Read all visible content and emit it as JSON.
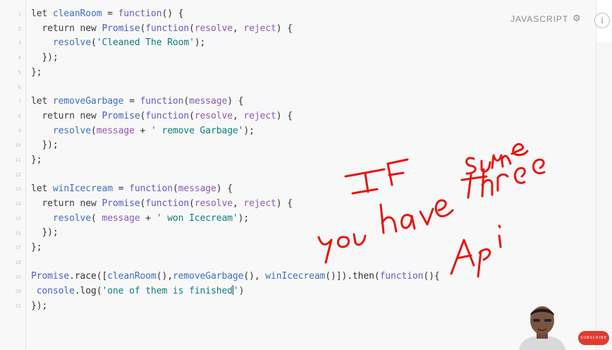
{
  "header": {
    "language": "JAVASCRIPT",
    "settings_icon": "gear-icon",
    "info_icon": "info-icon"
  },
  "line_numbers": [
    "1",
    "2",
    "3",
    "4",
    "5",
    "6",
    "7",
    "8",
    "9",
    "10",
    "11",
    "12",
    "13",
    "14",
    "15",
    "16",
    "17",
    "18",
    "19",
    "20",
    "21"
  ],
  "code_lines": [
    [
      {
        "t": "let ",
        "c": "kw"
      },
      {
        "t": "cleanRoom",
        "c": "def"
      },
      {
        "t": " = ",
        "c": "plain"
      },
      {
        "t": "function",
        "c": "fn"
      },
      {
        "t": "() {",
        "c": "plain"
      }
    ],
    [
      {
        "t": "  return new ",
        "c": "kw"
      },
      {
        "t": "Promise",
        "c": "lib"
      },
      {
        "t": "(",
        "c": "plain"
      },
      {
        "t": "function",
        "c": "fn"
      },
      {
        "t": "(",
        "c": "plain"
      },
      {
        "t": "resolve",
        "c": "param"
      },
      {
        "t": ", ",
        "c": "plain"
      },
      {
        "t": "reject",
        "c": "param"
      },
      {
        "t": ") {",
        "c": "plain"
      }
    ],
    [
      {
        "t": "    resolve",
        "c": "def"
      },
      {
        "t": "(",
        "c": "plain"
      },
      {
        "t": "'Cleaned The Room'",
        "c": "str"
      },
      {
        "t": ");",
        "c": "plain"
      }
    ],
    [
      {
        "t": "  });",
        "c": "plain"
      }
    ],
    [
      {
        "t": "};",
        "c": "plain"
      }
    ],
    [],
    [
      {
        "t": "let ",
        "c": "kw"
      },
      {
        "t": "removeGarbage",
        "c": "def"
      },
      {
        "t": " = ",
        "c": "plain"
      },
      {
        "t": "function",
        "c": "fn"
      },
      {
        "t": "(",
        "c": "plain"
      },
      {
        "t": "message",
        "c": "param"
      },
      {
        "t": ") {",
        "c": "plain"
      }
    ],
    [
      {
        "t": "  return new ",
        "c": "kw"
      },
      {
        "t": "Promise",
        "c": "lib"
      },
      {
        "t": "(",
        "c": "plain"
      },
      {
        "t": "function",
        "c": "fn"
      },
      {
        "t": "(",
        "c": "plain"
      },
      {
        "t": "resolve",
        "c": "param"
      },
      {
        "t": ", ",
        "c": "plain"
      },
      {
        "t": "reject",
        "c": "param"
      },
      {
        "t": ") {",
        "c": "plain"
      }
    ],
    [
      {
        "t": "    resolve",
        "c": "def"
      },
      {
        "t": "(",
        "c": "plain"
      },
      {
        "t": "message",
        "c": "param"
      },
      {
        "t": " + ",
        "c": "plain"
      },
      {
        "t": "' remove Garbage'",
        "c": "str"
      },
      {
        "t": ");",
        "c": "plain"
      }
    ],
    [
      {
        "t": "  });",
        "c": "plain"
      }
    ],
    [
      {
        "t": "};",
        "c": "plain"
      }
    ],
    [],
    [
      {
        "t": "let ",
        "c": "kw"
      },
      {
        "t": "winIcecream",
        "c": "def"
      },
      {
        "t": " = ",
        "c": "plain"
      },
      {
        "t": "function",
        "c": "fn"
      },
      {
        "t": "(",
        "c": "plain"
      },
      {
        "t": "message",
        "c": "param"
      },
      {
        "t": ") {",
        "c": "plain"
      }
    ],
    [
      {
        "t": "  return new ",
        "c": "kw"
      },
      {
        "t": "Promise",
        "c": "lib"
      },
      {
        "t": "(",
        "c": "plain"
      },
      {
        "t": "function",
        "c": "fn"
      },
      {
        "t": "(",
        "c": "plain"
      },
      {
        "t": "resolve",
        "c": "param"
      },
      {
        "t": ", ",
        "c": "plain"
      },
      {
        "t": "reject",
        "c": "param"
      },
      {
        "t": ") {",
        "c": "plain"
      }
    ],
    [
      {
        "t": "    resolve",
        "c": "def"
      },
      {
        "t": "( ",
        "c": "plain"
      },
      {
        "t": "message",
        "c": "param"
      },
      {
        "t": " + ",
        "c": "plain"
      },
      {
        "t": "' won Icecream'",
        "c": "str"
      },
      {
        "t": ");",
        "c": "plain"
      }
    ],
    [
      {
        "t": "  });",
        "c": "plain"
      }
    ],
    [
      {
        "t": "};",
        "c": "plain"
      }
    ],
    [],
    [
      {
        "t": "Promise",
        "c": "lib"
      },
      {
        "t": ".race([",
        "c": "plain"
      },
      {
        "t": "cleanRoom",
        "c": "def"
      },
      {
        "t": "(),",
        "c": "plain"
      },
      {
        "t": "removeGarbage",
        "c": "def"
      },
      {
        "t": "(), ",
        "c": "plain"
      },
      {
        "t": "winIcecream",
        "c": "def"
      },
      {
        "t": "()]).then(",
        "c": "plain"
      },
      {
        "t": "function",
        "c": "fn"
      },
      {
        "t": "(){",
        "c": "plain"
      }
    ],
    [
      {
        "t": " console",
        "c": "lib"
      },
      {
        "t": ".log(",
        "c": "plain"
      },
      {
        "t": "'one of them is finished",
        "c": "str"
      },
      {
        "t": "|cursor|",
        "c": "cursor"
      },
      {
        "t": "'",
        "c": "str"
      },
      {
        "t": ")",
        "c": "plain"
      }
    ],
    [
      {
        "t": "});",
        "c": "plain"
      }
    ]
  ],
  "annotation": {
    "words": [
      "If",
      "some",
      "you have three",
      "Api"
    ],
    "ink_color": "#e8140f"
  },
  "overlay": {
    "subscribe_label": "SUBSCRIBE"
  }
}
